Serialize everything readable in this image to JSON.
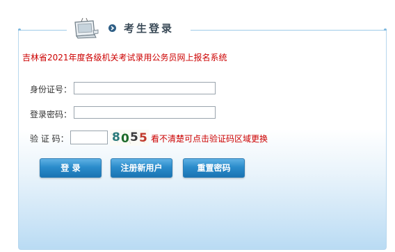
{
  "header": {
    "title": "考生登录",
    "icons": [
      "monitor-icon",
      "arrow-right-circle-icon"
    ]
  },
  "system_name": "吉林省2021年度各级机关考试录用公务员网上报名系统",
  "form": {
    "id_label": "身份证号：",
    "id_value": "",
    "password_label": "登录密码：",
    "password_value": "",
    "captcha_label": "验 证 码：",
    "captcha_value": "",
    "captcha_code": [
      "8",
      "0",
      "5",
      "5"
    ],
    "captcha_colors": [
      "#2a7a7a",
      "#1e6b2a",
      "#3a3a3a",
      "#c0392b"
    ],
    "captcha_hint": "看不清楚可点击验证码区域更换"
  },
  "buttons": {
    "login": "登 录",
    "register": "注册新用户",
    "reset": "重置密码"
  },
  "colors": {
    "accent": "#2b8ccb",
    "warning_text": "#cc0000",
    "border": "#b7d7ee"
  }
}
